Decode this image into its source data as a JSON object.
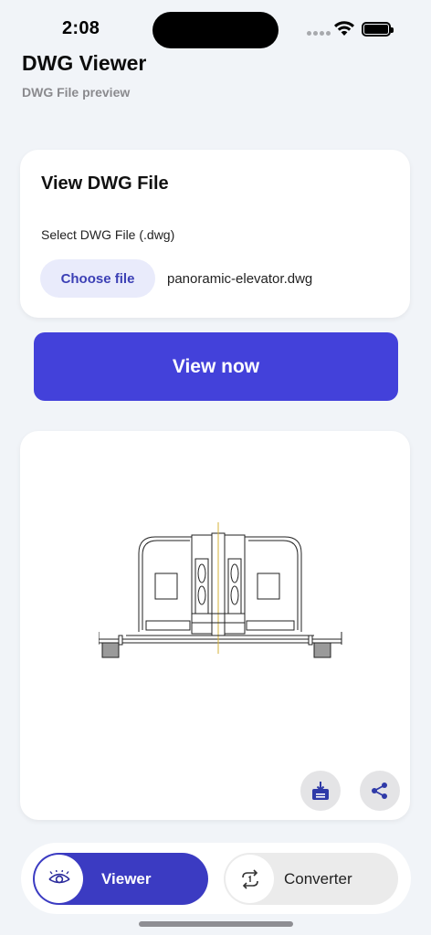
{
  "status_bar": {
    "time": "2:08"
  },
  "header": {
    "title": "DWG Viewer",
    "subtitle": "DWG File preview"
  },
  "file_card": {
    "title": "View DWG File",
    "label": "Select DWG File (.dwg)",
    "choose_button": "Choose file",
    "file_name": "panoramic-elevator.dwg"
  },
  "view_button": {
    "label": "View now"
  },
  "preview": {
    "download_icon": "download-tray-icon",
    "share_icon": "share-icon"
  },
  "bottom_nav": {
    "tabs": [
      {
        "label": "Viewer",
        "icon": "eye-icon",
        "active": true
      },
      {
        "label": "Converter",
        "icon": "convert-cycle-icon",
        "active": false
      }
    ]
  },
  "colors": {
    "accent": "#4341da",
    "nav_active": "#3b3bc2",
    "background": "#f1f4f8",
    "chip_bg": "#e9ebfb"
  }
}
